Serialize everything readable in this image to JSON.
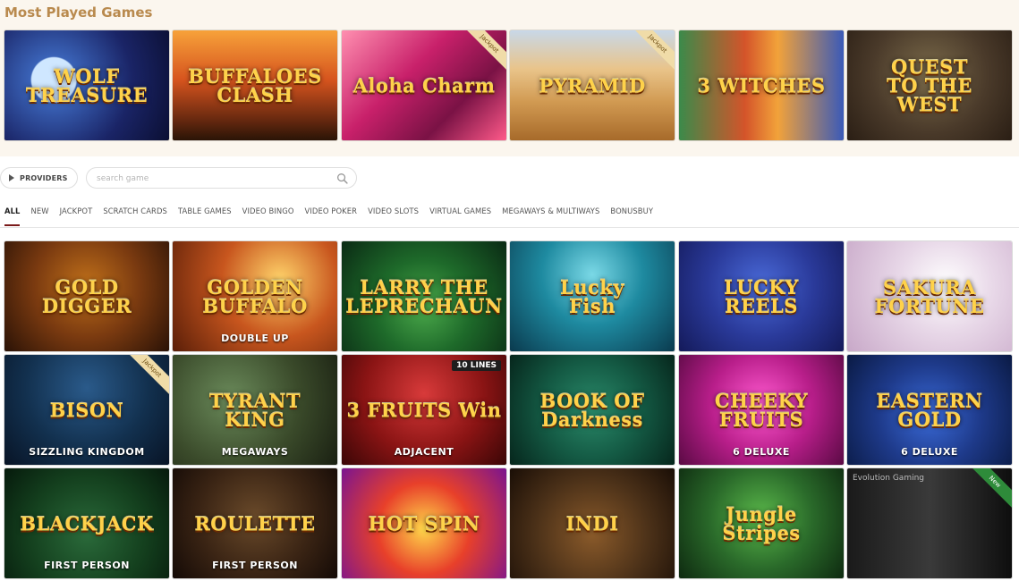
{
  "most_played": {
    "title": "Most Played Games",
    "games": [
      {
        "title": "WOLF\nTREASURE",
        "subtitle": "",
        "badge": "",
        "bg": "radial-gradient(circle at 30% 45%, #cfe7ff 0 17%, #3a63b8 18%, #1a2466 60%, #0b0f33 100%)",
        "border": "#d8b450"
      },
      {
        "title": "BUFFALOES CLASH",
        "subtitle": "",
        "badge": "",
        "bg": "linear-gradient(180deg, #f7a23a 0%, #d6541e 45%, #6b2a10 80%, #2a1406 100%)",
        "border": "#c98a2a"
      },
      {
        "title": "Aloha Charm",
        "subtitle": "",
        "badge": "Jackpot",
        "bg": "linear-gradient(135deg, #ff8fb0 0%, #c8206a 40%, #7a1245 70%, #ff5a8a 100%)",
        "border": "#d64a8a"
      },
      {
        "title": "PYRAMID",
        "subtitle": "",
        "badge": "Jackpot",
        "bg": "linear-gradient(180deg, #c8d8e8 0%, #e9c48a 35%, #d19a52 65%, #a76a2a 100%)",
        "border": "#d7b66b"
      },
      {
        "title": "3 WITCHES",
        "subtitle": "",
        "badge": "",
        "bg": "linear-gradient(90deg, #3b8a4a 0%, #d4542a 40%, #f2a23a 60%, #3a5ab8 100%)",
        "border": "#e0c050"
      },
      {
        "title": "QUEST\nTO THE\nWEST",
        "subtitle": "",
        "badge": "",
        "bg": "radial-gradient(circle at 50% 40%, #7a6a4a 0%, #4a3a2a 55%, #2a1e14 100%)",
        "border": "#6a5030"
      }
    ]
  },
  "filters": {
    "providers_label": "PROVIDERS",
    "search_placeholder": "search game"
  },
  "tabs": [
    "ALL",
    "NEW",
    "JACKPOT",
    "SCRATCH CARDS",
    "TABLE GAMES",
    "VIDEO BINGO",
    "VIDEO POKER",
    "VIDEO SLOTS",
    "VIRTUAL GAMES",
    "MEGAWAYS & MULTIWAYS",
    "BONUSBUY"
  ],
  "active_tab": "ALL",
  "games": [
    {
      "title": "GOLD\nDIGGER",
      "subtitle": "",
      "badge": "",
      "lines": "",
      "bg": "radial-gradient(circle at 50% 40%, #c0701a 0%, #7a3a10 50%, #2a1206 100%)"
    },
    {
      "title": "GOLDEN\nBUFFALO",
      "subtitle": "DOUBLE UP",
      "badge": "",
      "lines": "",
      "bg": "radial-gradient(circle at 65% 35%, #ffd36a 0%, #c8561e 45%, #5a1e08 100%)"
    },
    {
      "title": "LARRY THE\nLEPRECHAUN",
      "subtitle": "",
      "badge": "",
      "lines": "",
      "bg": "radial-gradient(circle at 50% 60%, #4aa84a 0%, #1e6a2a 45%, #0a2a14 100%)"
    },
    {
      "title": "Lucky\nFish",
      "subtitle": "",
      "badge": "",
      "lines": "",
      "bg": "radial-gradient(circle at 50% 30%, #7ad8e6 0%, #1e8aa0 45%, #0a3a4e 100%)"
    },
    {
      "title": "LUCKY\nREELS",
      "subtitle": "",
      "badge": "",
      "lines": "",
      "bg": "radial-gradient(circle at 50% 40%, #4a6ad8 0%, #2a3a9a 50%, #141a5a 100%)"
    },
    {
      "title": "SAKURA\nFORTUNE",
      "subtitle": "",
      "badge": "",
      "lines": "",
      "bg": "radial-gradient(circle at 60% 40%, #ffffff 0%, #e8d8e8 40%, #c8a8c8 100%)"
    },
    {
      "title": "BISON",
      "subtitle": "SIZZLING KINGDOM",
      "badge": "Jackpot",
      "lines": "",
      "bg": "radial-gradient(circle at 50% 30%, #2a5a8a 0%, #12304e 55%, #081426 100%)"
    },
    {
      "title": "TYRANT\nKING",
      "subtitle": "MEGAWAYS",
      "badge": "",
      "lines": "",
      "bg": "radial-gradient(circle at 35% 40%, #6a8a5a 0%, #3a4a2a 55%, #1a2012 100%)"
    },
    {
      "title": "3 FRUITS Win",
      "subtitle": "ADJACENT",
      "badge": "",
      "lines": "10 LINES",
      "bg": "radial-gradient(circle at 50% 35%, #d83a3a 0%, #8a1414 55%, #3a0606 100%)"
    },
    {
      "title": "BOOK OF\nDarkness",
      "subtitle": "",
      "badge": "",
      "lines": "",
      "bg": "radial-gradient(circle at 50% 50%, #2a8a6a 0%, #145a44 50%, #06261c 100%)"
    },
    {
      "title": "CHEEKY\nFRUITS",
      "subtitle": "6 DELUXE",
      "badge": "",
      "lines": "",
      "bg": "radial-gradient(circle at 50% 45%, #ff5ad0 0%, #b81e8a 50%, #5a0a44 100%)"
    },
    {
      "title": "EASTERN GOLD",
      "subtitle": "6 DELUXE",
      "badge": "",
      "lines": "",
      "bg": "radial-gradient(circle at 50% 55%, #3a6ad8 0%, #1e3a8a 50%, #0a1a44 100%)"
    },
    {
      "title": "BLACKJACK",
      "subtitle": "FIRST PERSON",
      "badge": "",
      "lines": "",
      "bg": "radial-gradient(circle at 50% 60%, #2a6a3a 0%, #14401e 55%, #061a0c 100%)"
    },
    {
      "title": "ROULETTE",
      "subtitle": "FIRST PERSON",
      "badge": "",
      "lines": "",
      "bg": "radial-gradient(circle at 50% 45%, #6a4a2a 0%, #3a2414 55%, #140a06 100%)"
    },
    {
      "title": "HOT SPIN",
      "subtitle": "",
      "badge": "",
      "lines": "",
      "bg": "radial-gradient(circle at 50% 55%, #ffd84a 0%, #e8402a 45%, #7a1490 100%)"
    },
    {
      "title": "INDI",
      "subtitle": "",
      "badge": "",
      "lines": "",
      "bg": "radial-gradient(circle at 50% 60%, #8a5a2a 0%, #4a3018 55%, #1a0e06 100%)"
    },
    {
      "title": "Jungle\nStripes",
      "subtitle": "",
      "badge": "",
      "lines": "",
      "bg": "radial-gradient(circle at 50% 45%, #5ab84a 0%, #2a6a2a 50%, #0e2a10 100%)"
    },
    {
      "title": "",
      "subtitle": "",
      "badge": "New",
      "lines": "",
      "logo": "Evolution Gaming",
      "bg": "linear-gradient(90deg, #1a1a1a 0%, #3a3a3a 50%, #0e0e0e 100%)"
    }
  ]
}
